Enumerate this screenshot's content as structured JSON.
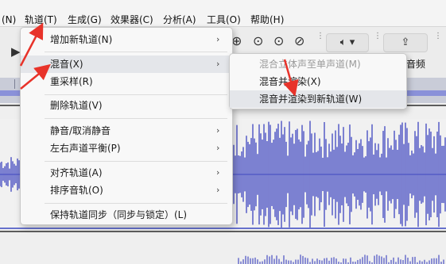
{
  "menubar": {
    "items": [
      {
        "label": "(N)"
      },
      {
        "label": "轨道(T)"
      },
      {
        "label": "生成(G)"
      },
      {
        "label": "效果器(C)"
      },
      {
        "label": "分析(A)"
      },
      {
        "label": "工具(O)"
      },
      {
        "label": "帮助(H)"
      }
    ]
  },
  "toolbar": {
    "partial_label": "音频"
  },
  "track_menu": {
    "items": [
      {
        "label": "增加新轨道(N)"
      },
      {
        "label": "混音(X)"
      },
      {
        "label": "重采样(R)"
      },
      {
        "label": "删除轨道(V)"
      },
      {
        "label": "静音/取消静音"
      },
      {
        "label": "左右声道平衡(P)"
      },
      {
        "label": "对齐轨道(A)"
      },
      {
        "label": "排序音轨(O)"
      },
      {
        "label": "保持轨道同步（同步与锁定）(L)"
      }
    ]
  },
  "mix_submenu": {
    "items": [
      {
        "label": "混合立体声至单声道(M)"
      },
      {
        "label": "混音并渲染(X)"
      },
      {
        "label": "混音并渲染到新轨道(W)"
      }
    ]
  },
  "colors": {
    "waveform": "#5f65c9",
    "annotation_arrow": "#e8332a",
    "timeline_strip": "#8a91d9"
  }
}
